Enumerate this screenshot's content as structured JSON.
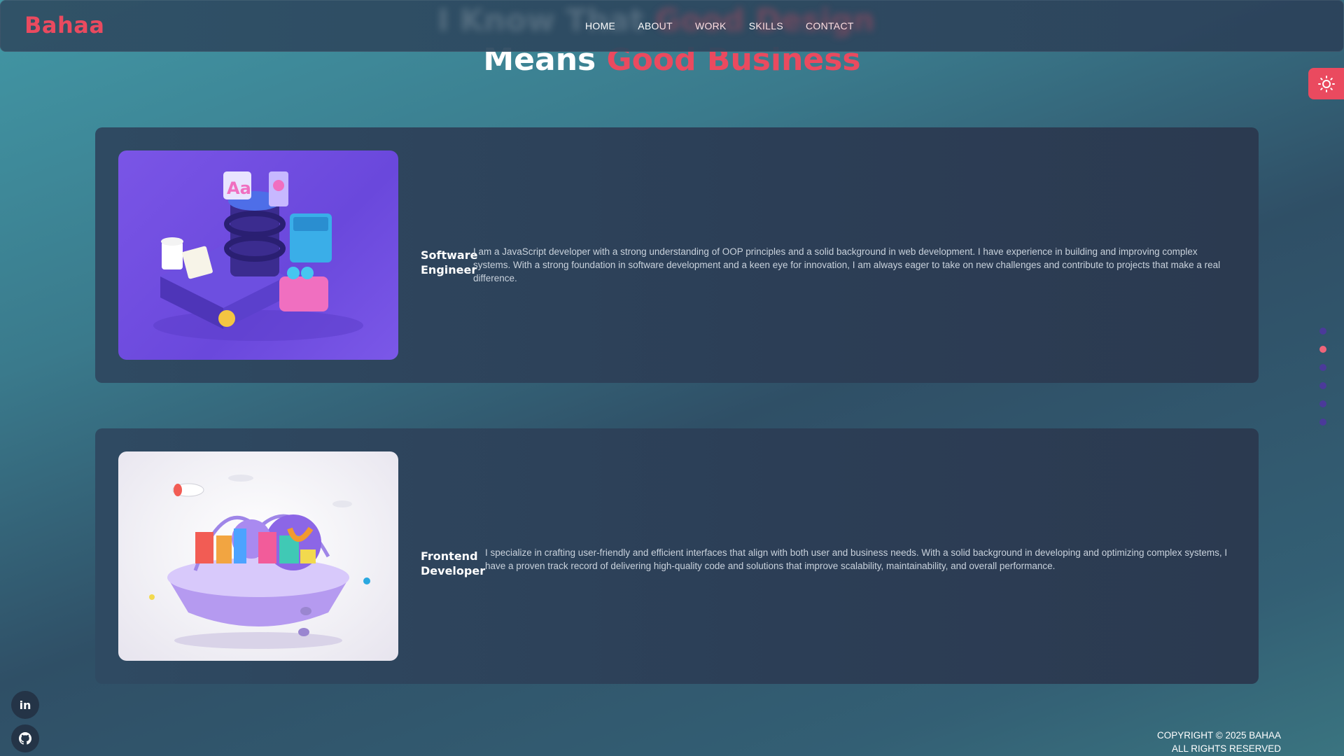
{
  "header": {
    "logo": "Bahaa",
    "nav": [
      "HOME",
      "ABOUT",
      "WORK",
      "SKILLS",
      "CONTACT"
    ]
  },
  "heading": {
    "blurred_line": "I Know That",
    "blurred_accent": "Good Design",
    "line_plain": "Means",
    "line_accent": "Good Business"
  },
  "cards": [
    {
      "title": "Software Engineer",
      "text": "I am a JavaScript developer with a strong understanding of OOP principles and a solid background in web development. I have experience in building and improving complex systems. With a strong foundation in software development and a keen eye for innovation, I am always eager to take on new challenges and contribute to projects that make a real difference."
    },
    {
      "title": "Frontend Developer",
      "text": "I specialize in crafting user-friendly and efficient interfaces that align with both user and business needs. With a solid background in developing and optimizing complex systems, I have a proven track record of delivering high-quality code and solutions that improve scalability, maintainability, and overall performance."
    }
  ],
  "footer": {
    "line1": "COPYRIGHT © 2025 BAHAA",
    "line2": "ALL RIGHTS RESERVED"
  },
  "colors": {
    "accent": "#ea4a5f",
    "card_bg": "#2d4159",
    "dot_inactive": "#4b3a9a",
    "dot_active": "#f0657a"
  },
  "icons": {
    "theme_toggle": "sun-icon",
    "social": [
      "linkedin-icon",
      "github-icon"
    ]
  },
  "pager": {
    "count": 6,
    "active_index": 1
  }
}
